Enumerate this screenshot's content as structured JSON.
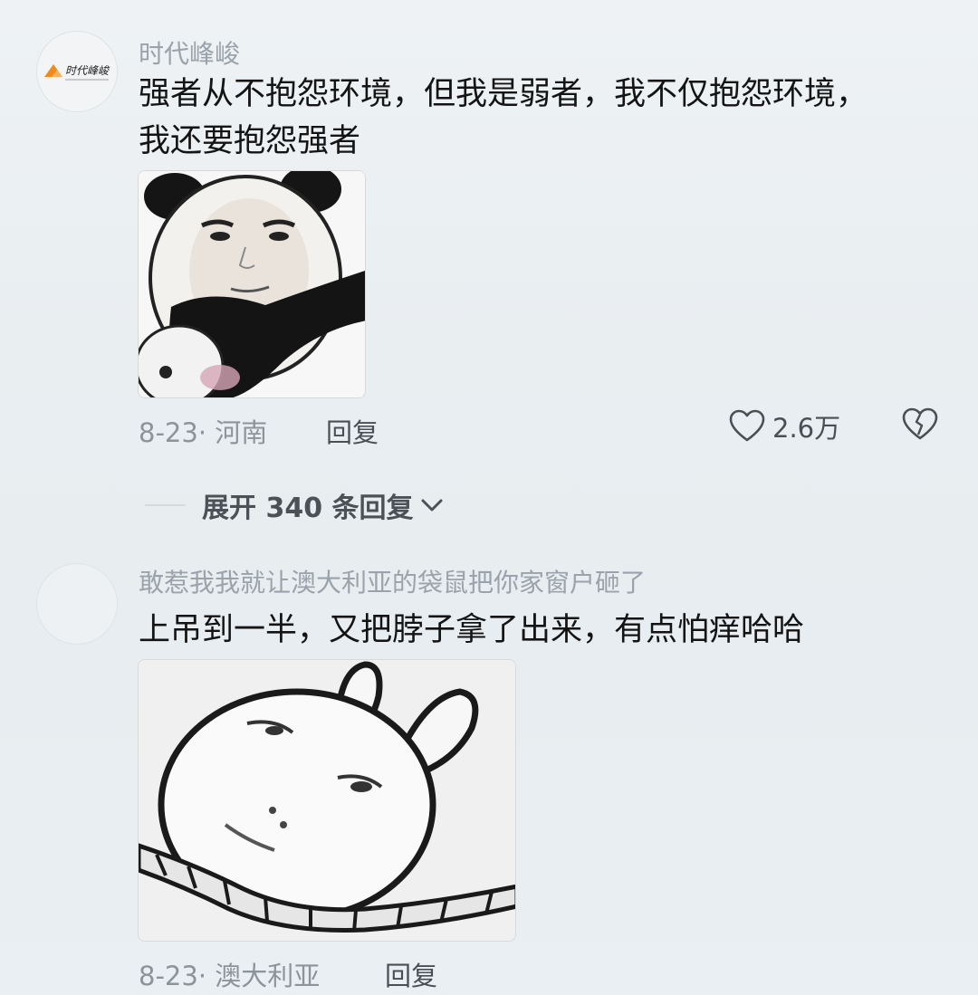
{
  "comments": [
    {
      "username": "时代峰峻",
      "avatar": "logo-avatar",
      "text_line1": "强者从不抱怨环境，但我是弱者，我不仅抱怨环境，",
      "text_line2": "我还要抱怨强者",
      "image": "panda-face-meme",
      "date": "8-23",
      "location": "河南",
      "reply_label": "回复",
      "likes": "2.6万"
    },
    {
      "username": "敢惹我我就让澳大利亚的袋鼠把你家窗户砸了",
      "avatar": "blank-avatar",
      "text": "上吊到一半，又把脖子拿了出来，有点怕痒哈哈",
      "image": "rabbit-noose-meme",
      "date": "8-23",
      "location": "澳大利亚",
      "reply_label": "回复"
    }
  ],
  "expand": {
    "label": "展开 340 条回复"
  },
  "colors": {
    "logo_orange": "#f08a1c",
    "text": "#141414",
    "muted": "#9aa3ab"
  }
}
